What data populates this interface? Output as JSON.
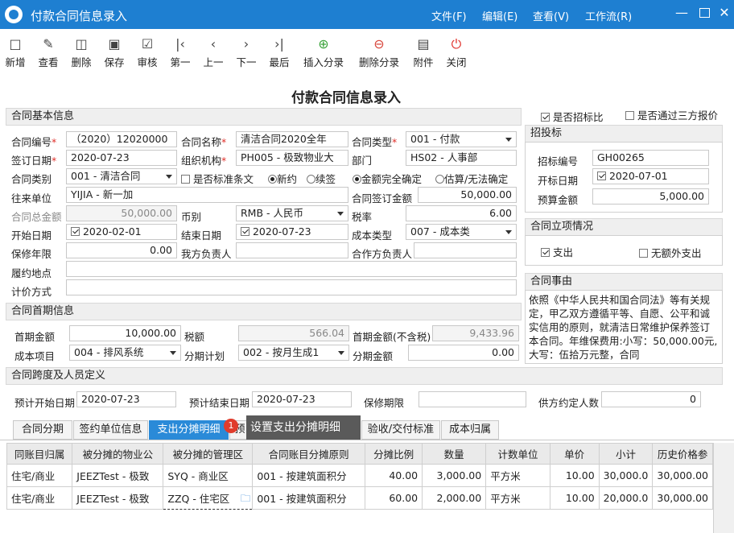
{
  "window": {
    "title": "付款合同信息录入",
    "menus": [
      "文件(F)",
      "编辑(E)",
      "查看(V)",
      "工作流(R)"
    ]
  },
  "toolbar": [
    "新增",
    "查看",
    "删除",
    "保存",
    "审核",
    "第一",
    "上一",
    "下一",
    "最后",
    "插入分录",
    "删除分录",
    "附件",
    "关闭"
  ],
  "page_title": "付款合同信息录入",
  "basic": {
    "section": "合同基本信息",
    "contract_no_label": "合同编号",
    "contract_no": "（2020）12020000",
    "contract_name_label": "合同名称",
    "contract_name": "清洁合同2020全年",
    "contract_type_label": "合同类型",
    "contract_type": "001 - 付款",
    "sign_date_label": "签订日期",
    "sign_date": "2020-07-23",
    "org_label": "组织机构",
    "org": "PH005 - 极致物业大",
    "dept_label": "部门",
    "dept": "HS02 - 人事部",
    "category_label": "合同类别",
    "category": "001 - 清洁合同",
    "std_label": "是否标准条文",
    "new_label": "新约",
    "renew_label": "续签",
    "amt_fixed_label": "金额完全确定",
    "amt_est_label": "估算/无法确定",
    "partner_label": "往来单位",
    "partner": "YIJIA - 新一加",
    "sign_amount_label": "合同签订金额",
    "sign_amount": "50,000.00",
    "total_label": "合同总金额",
    "total": "50,000.00",
    "currency_label": "币别",
    "currency": "RMB - 人民币",
    "rate_label": "税率",
    "rate": "6.00",
    "start_label": "开始日期",
    "start": "2020-02-01",
    "end_label": "结束日期",
    "end": "2020-07-23",
    "cost_type_label": "成本类型",
    "cost_type": "007 - 成本类",
    "warranty_label": "保修年限",
    "warranty": "0.00",
    "our_person_label": "我方负责人",
    "partner_person_label": "合作方负责人",
    "place_label": "履约地点",
    "pricing_label": "计价方式"
  },
  "bid": {
    "is_bid_label": "是否招标比",
    "third_label": "是否通过三方报价",
    "section": "招投标",
    "no_label": "招标编号",
    "no": "GH00265",
    "open_label": "开标日期",
    "open": "2020-07-01",
    "budget_label": "预算金额",
    "budget": "5,000.00"
  },
  "project": {
    "section": "合同立项情况",
    "expense_label": "支出",
    "noextra_label": "无额外支出"
  },
  "matter": {
    "section": "合同事由",
    "text": "依照《中华人民共和国合同法》等有关规定，甲乙双方遵循平等、自愿、公平和诚实信用的原则，就清洁日常维护保养签订本合同。年维保费用:小写：50,000.00元,大写：伍拾万元整，合同"
  },
  "first": {
    "section": "合同首期信息",
    "amount_label": "首期金额",
    "amount": "10,000.00",
    "tax_label": "税额",
    "tax": "566.04",
    "notax_label": "首期金额(不含税)",
    "notax": "9,433.96",
    "item_label": "成本项目",
    "item": "004 - 排风系统",
    "plan_label": "分期计划",
    "plan": "002 - 按月生成1",
    "inst_label": "分期金额",
    "inst": "0.00"
  },
  "span": {
    "section": "合同跨度及人员定义",
    "pstart_label": "预计开始日期",
    "pstart": "2020-07-23",
    "pend_label": "预计结束日期",
    "pend": "2020-07-23",
    "wperiod_label": "保修期限",
    "supplier_label": "供方约定人数",
    "supplier": "0"
  },
  "tabs": [
    "合同分期",
    "签约单位信息",
    "支出分摊明细",
    "预",
    "验收/交付标准",
    "成本归属"
  ],
  "tooltip": {
    "badge": "1",
    "text": "设置支出分摊明细"
  },
  "table": {
    "headers": [
      "同账目归属",
      "被分摊的物业公",
      "被分摊的管理区",
      "合同账目分摊原则",
      "分摊比例",
      "数量",
      "计数单位",
      "单价",
      "小计",
      "历史价格参"
    ],
    "rows": [
      [
        "住宅/商业",
        "JEEZTest - 极致",
        "SYQ - 商业区",
        "001 - 按建筑面积分",
        "40.00",
        "3,000.00",
        "平方米",
        "10.00",
        "30,000.0",
        "30,000.00"
      ],
      [
        "住宅/商业",
        "JEEZTest - 极致",
        "ZZQ - 住宅区",
        "001 - 按建筑面积分",
        "60.00",
        "2,000.00",
        "平方米",
        "10.00",
        "20,000.0",
        "30,000.00"
      ]
    ]
  }
}
